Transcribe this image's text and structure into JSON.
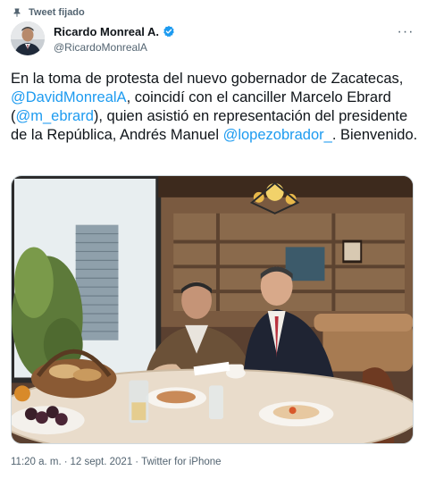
{
  "pinned": {
    "label": "Tweet fijado",
    "icon": "pin-icon"
  },
  "author": {
    "display_name": "Ricardo Monreal A.",
    "handle": "@RicardoMonrealA",
    "verified": true,
    "verified_color": "#1d9bf0"
  },
  "menu": {
    "icon": "more-options-icon",
    "glyph": "···"
  },
  "tweet": {
    "segments": [
      {
        "text": "En la toma de protesta del nuevo gobernador de Zacatecas, ",
        "mention": false
      },
      {
        "text": "@DavidMonrealA",
        "mention": true
      },
      {
        "text": ", coincidí con el canciller Marcelo Ebrard (",
        "mention": false
      },
      {
        "text": "@m_ebrard",
        "mention": true
      },
      {
        "text": "), quien asistió en representación del presidente de la República, Andrés Manuel ",
        "mention": false
      },
      {
        "text": "@lopezobrador_",
        "mention": true
      },
      {
        "text": ". Bienvenido.",
        "mention": false
      }
    ]
  },
  "media": {
    "kind": "photo"
  },
  "meta": {
    "time": "11:20 a. m.",
    "separator": "·",
    "date": "12 sept. 2021",
    "source": "Twitter for iPhone"
  },
  "colors": {
    "mention": "#1d9bf0",
    "secondary_text": "#536471"
  }
}
